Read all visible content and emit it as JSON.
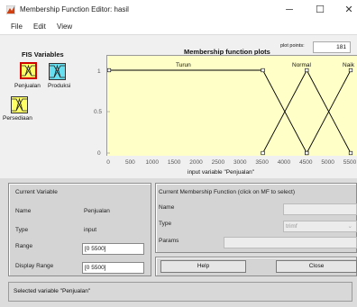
{
  "window": {
    "title": "Membership Function Editor: hasil",
    "minimize": "─",
    "maximize": "☐",
    "close": "✕"
  },
  "menu": [
    "File",
    "Edit",
    "View"
  ],
  "fis_variables": {
    "title": "FIS Variables",
    "items": [
      {
        "label": "Penjualan",
        "selected": true,
        "color": "#ffff66"
      },
      {
        "label": "Produksi",
        "selected": false,
        "color": "#66e0f0"
      },
      {
        "label": "Persediaan",
        "selected": false,
        "color": "#ffff66"
      }
    ]
  },
  "plot": {
    "title": "Membership function plots",
    "plot_points_label": "plot points:",
    "plot_points_value": "181",
    "xlabel": "input variable \"Penjualan\"",
    "yticks": [
      "1",
      "0.5",
      "0"
    ],
    "xticks": [
      "0",
      "500",
      "1000",
      "1500",
      "2000",
      "2500",
      "3000",
      "3500",
      "4000",
      "4500",
      "5000",
      "5500"
    ],
    "mf_labels": [
      "Turun",
      "Normal",
      "Naik"
    ],
    "colors": {
      "background": "#ffffc8",
      "mf_selected": "#c80000",
      "mf_line": "#000000"
    }
  },
  "chart_data": {
    "type": "line",
    "xlabel": "input variable \"Penjualan\"",
    "ylabel": "",
    "xlim": [
      0,
      5500
    ],
    "ylim": [
      0,
      1
    ],
    "series": [
      {
        "name": "Turun",
        "x": [
          0,
          3500,
          4500
        ],
        "y": [
          1,
          1,
          0
        ]
      },
      {
        "name": "Normal",
        "x": [
          3500,
          4500,
          5500
        ],
        "y": [
          0,
          1,
          0
        ]
      },
      {
        "name": "Naik",
        "x": [
          4500,
          5500
        ],
        "y": [
          0,
          1
        ]
      }
    ]
  },
  "current_variable": {
    "header": "Current Variable",
    "name_label": "Name",
    "name_value": "Penjualan",
    "type_label": "Type",
    "type_value": "input",
    "range_label": "Range",
    "range_value": "[0 5500]",
    "display_range_label": "Display Range",
    "display_range_value": "[0 5500]"
  },
  "current_mf": {
    "header": "Current Membership Function (click on MF to select)",
    "name_label": "Name",
    "name_value": "",
    "type_label": "Type",
    "type_value": "trimf",
    "params_label": "Params",
    "params_value": ""
  },
  "buttons": {
    "help": "Help",
    "close": "Close"
  },
  "status": "Selected variable \"Penjualan\""
}
